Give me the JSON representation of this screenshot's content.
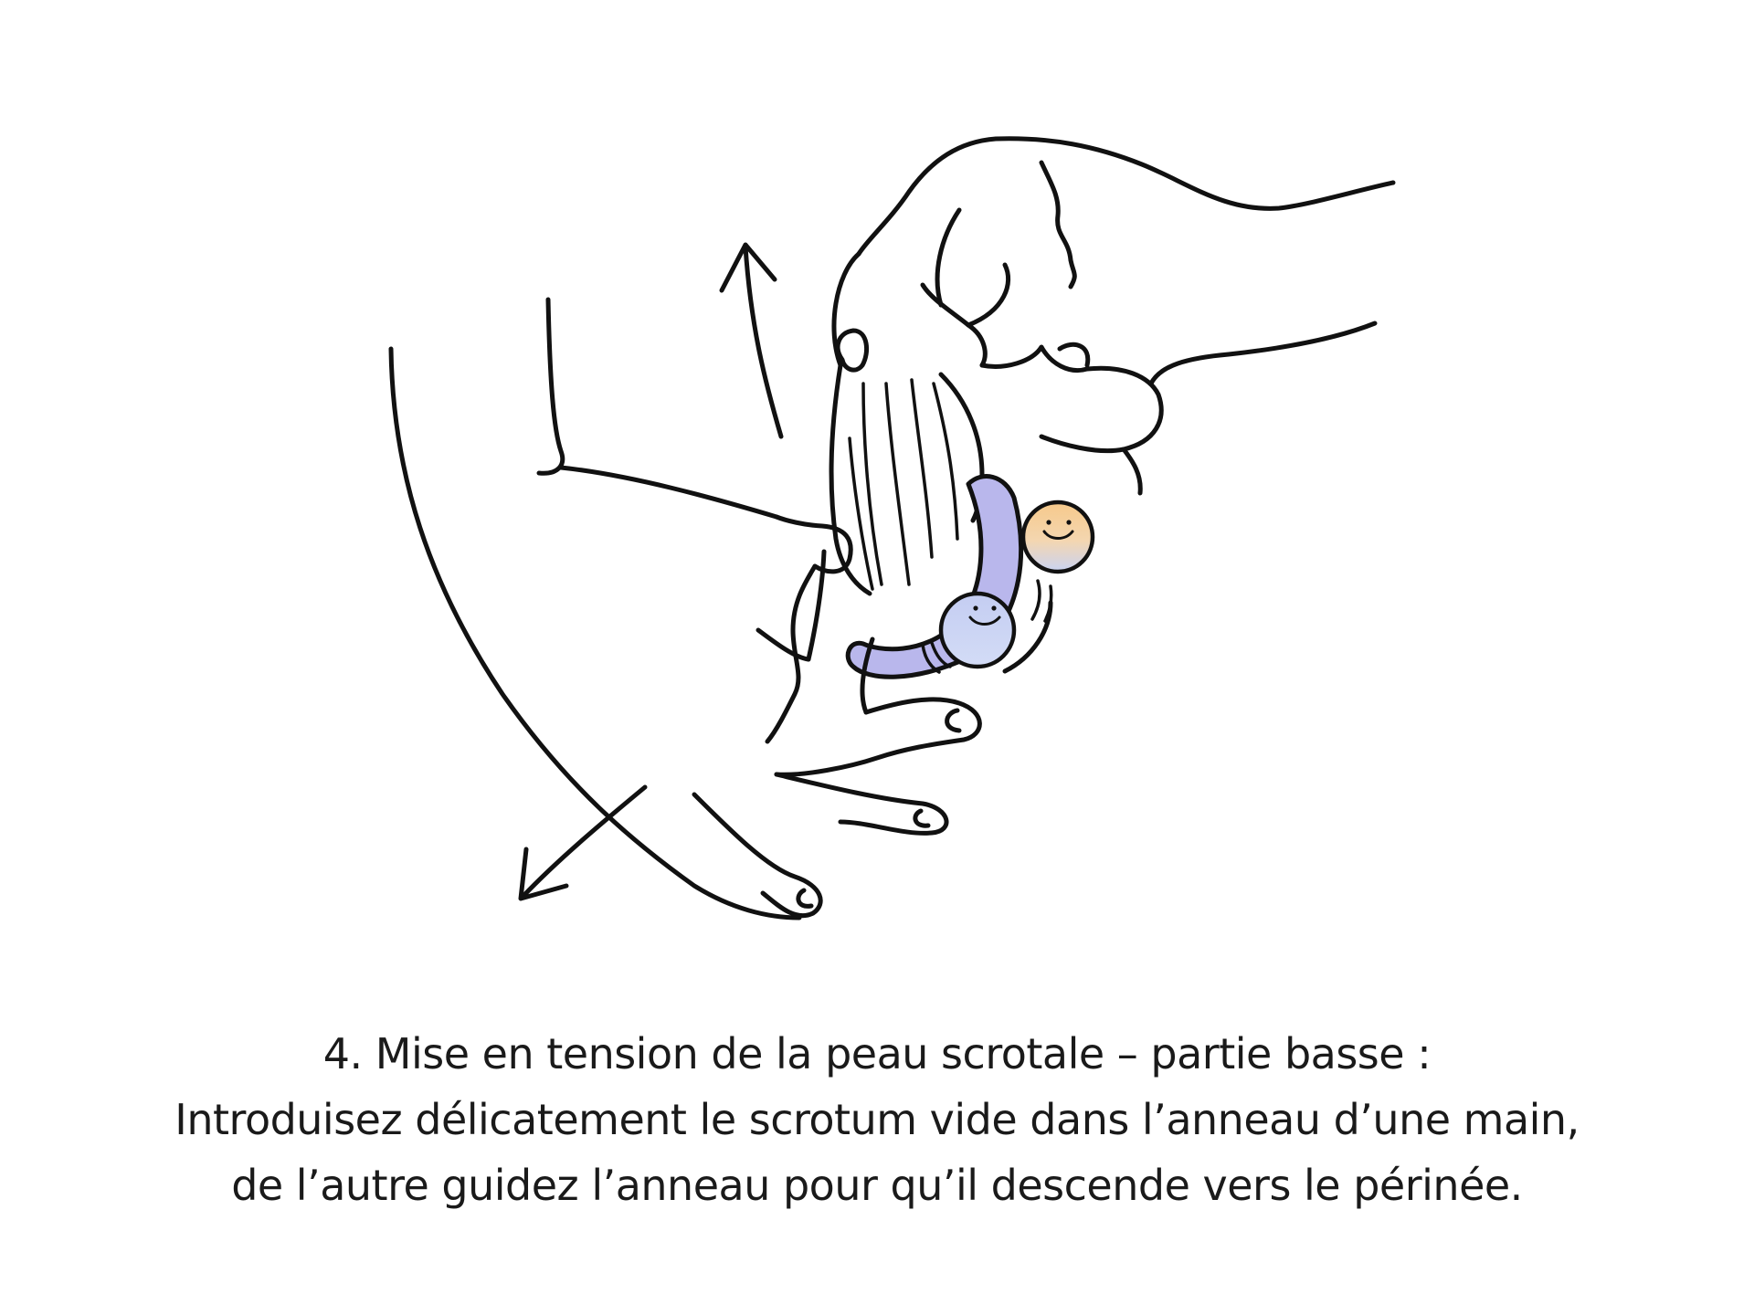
{
  "caption": {
    "line1": "4. Mise en tension de la peau scrotale – partie basse :",
    "line2": "Introduisez délicatement le scrotum vide dans l’anneau d’une main,",
    "line3": "de l’autre guidez l’anneau pour qu’il descende vers le périnée."
  },
  "colors": {
    "ring": "#b9b7ec",
    "ball_orange": "#f2c48b",
    "ball_blue": "#c9d4f3",
    "ink": "#111111"
  }
}
